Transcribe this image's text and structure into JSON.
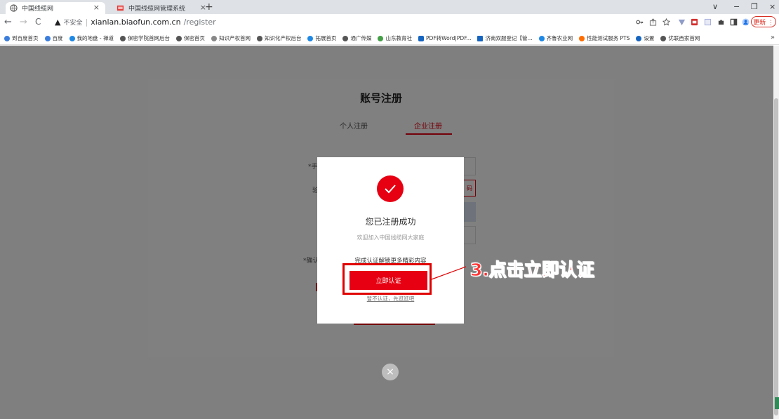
{
  "browser": {
    "tabs": [
      {
        "title": "中国线缆网",
        "active": true
      },
      {
        "title": "中国线缆网管理系统",
        "active": false
      }
    ],
    "new_tab": "+",
    "tab_close": "×",
    "window_controls": {
      "dropdown": "∨",
      "minimize": "−",
      "restore": "❐",
      "close": "×"
    },
    "nav": {
      "back": "←",
      "forward": "→",
      "reload": "C"
    },
    "address": {
      "warning": "▲",
      "insecure_label": "不安全",
      "host": "xianlan.biaofun.com.cn",
      "path": "/register"
    },
    "update_label": "更新 ⋮",
    "bookmarks": [
      {
        "label": "到百度首页",
        "color": "#3b7ddd"
      },
      {
        "label": "百度",
        "color": "#3b7ddd"
      },
      {
        "label": "我的地盘 - 禅道",
        "color": "#1e88e5"
      },
      {
        "label": "保密学院首网后台",
        "color": "#555555"
      },
      {
        "label": "保密首页",
        "color": "#555555"
      },
      {
        "label": "知识产权首网",
        "color": "#888888"
      },
      {
        "label": "知识化产权后台",
        "color": "#555555"
      },
      {
        "label": "拓展首页",
        "color": "#1e88e5"
      },
      {
        "label": "通广传媒",
        "color": "#555555"
      },
      {
        "label": "山东教育社",
        "color": "#43a047"
      },
      {
        "label": "PDF转Word|PDF...",
        "color": "#1565c0"
      },
      {
        "label": "济南双服登记【管...",
        "color": "#1565c0"
      },
      {
        "label": "齐鲁农业网",
        "color": "#1e88e5"
      },
      {
        "label": "性能测试服务 PTS",
        "color": "#ff6d00"
      },
      {
        "label": "设置",
        "color": "#1565c0"
      },
      {
        "label": "优联西家首网",
        "color": "#555555"
      }
    ],
    "bookmarks_more": "»"
  },
  "register": {
    "title": "账号注册",
    "tab_personal": "个人注册",
    "tab_company": "企业注册",
    "label_phone": "*手",
    "label_code": "验",
    "label_confirm": "*确认",
    "code_button": "码"
  },
  "modal": {
    "title": "您已注册成功",
    "subtitle": "欢迎加入中国线缆网大家庭",
    "tip": "完成认证解锁更多精彩内容",
    "certify_button": "立即认证",
    "skip_link": "暂不认证，先逛逛吧",
    "close": "×"
  },
  "annotation": {
    "callout": "3.点击立即认证"
  },
  "colors": {
    "accent": "#e60012",
    "callout": "#ff3030",
    "overlay": "rgba(0,0,0,0.5)"
  }
}
